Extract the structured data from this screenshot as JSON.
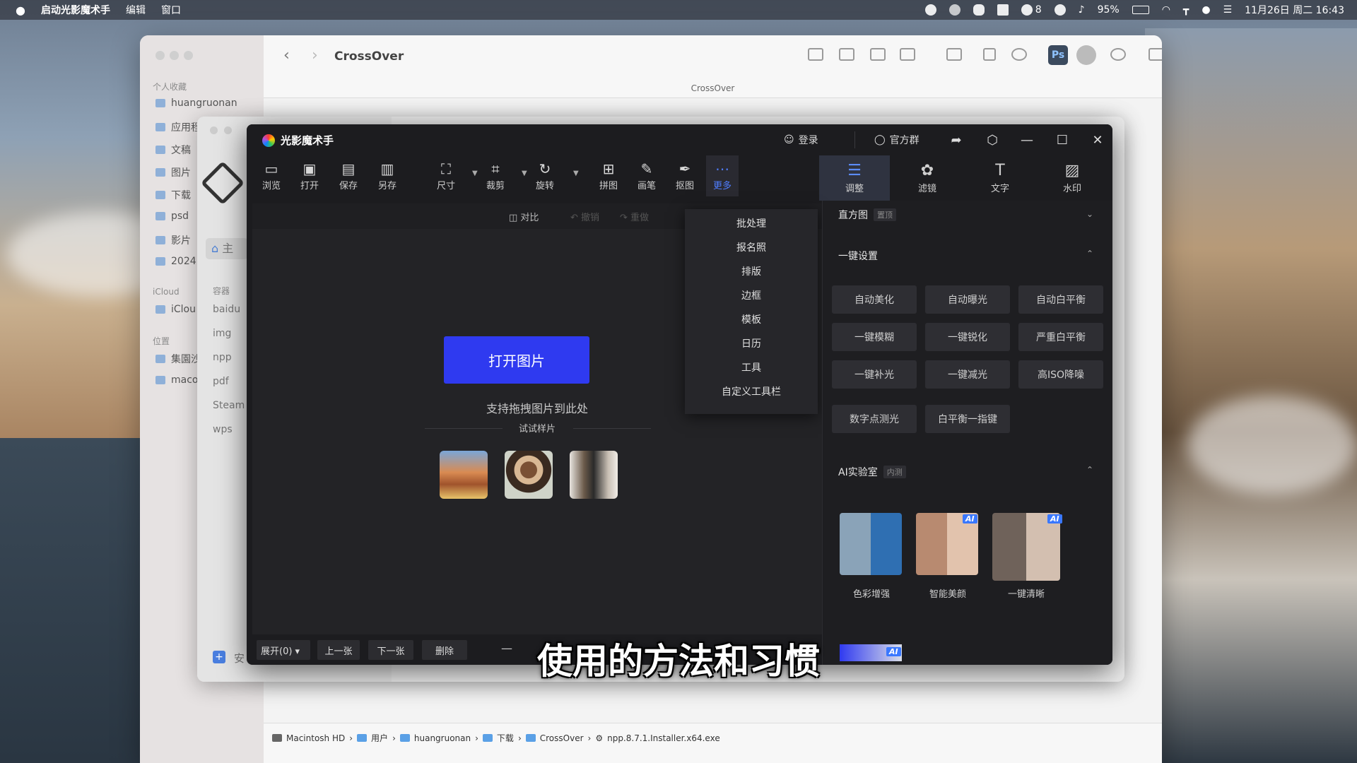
{
  "menubar": {
    "app_name": "启动光影魔术手",
    "menus": [
      "编辑",
      "窗口"
    ],
    "wechat_count": "8",
    "battery": "95%",
    "datetime": "11月26日 周二 16:43"
  },
  "finder": {
    "title": "CrossOver",
    "subtitle": "CrossOver",
    "sidebar_sections": {
      "favorites": "个人收藏",
      "icloud": "iCloud",
      "locations": "位置"
    },
    "favorites": [
      "huangruonan",
      "应用程",
      "文稿",
      "图片",
      "下载",
      "psd",
      "影片",
      "2024"
    ],
    "icloud_items": [
      "iClou"
    ],
    "locations": [
      "集園沙",
      "maco"
    ],
    "path": [
      "Macintosh HD",
      "用户",
      "huangruonan",
      "下载",
      "CrossOver",
      "npp.8.7.1.Installer.x64.exe"
    ]
  },
  "crossover": {
    "home_label": "主",
    "section": "容器",
    "items": [
      "baidu",
      "img",
      "npp",
      "pdf",
      "Steam",
      "wps"
    ],
    "add_label": "安"
  },
  "app": {
    "title": "光影魔术手",
    "login": "登录",
    "group": "官方群",
    "tools": [
      "浏览",
      "打开",
      "保存",
      "另存",
      "尺寸",
      "裁剪",
      "旋转",
      "拼图",
      "画笔",
      "抠图",
      "更多"
    ],
    "right_tools": [
      "调整",
      "滤镜",
      "文字",
      "水印"
    ],
    "subbar": {
      "compare": "对比",
      "undo": "撤销",
      "redo": "重做"
    },
    "open_button": "打开图片",
    "drag_hint": "支持拖拽图片到此处",
    "try_sample": "试试样片",
    "more_menu": [
      "批处理",
      "报名照",
      "排版",
      "边框",
      "模板",
      "日历",
      "工具",
      "自定义工具栏"
    ],
    "panel": {
      "histogram": {
        "title": "直方图",
        "tag": "置顶"
      },
      "oneclick": {
        "title": "一键设置",
        "buttons": [
          "自动美化",
          "自动曝光",
          "自动白平衡",
          "一键模糊",
          "一键锐化",
          "严重白平衡",
          "一键补光",
          "一键减光",
          "高ISO降噪",
          "数字点测光",
          "白平衡一指键"
        ]
      },
      "ailab": {
        "title": "AI实验室",
        "tag": "内测",
        "items": [
          "色彩增强",
          "智能美颜",
          "一键清晰"
        ],
        "badge": "AI"
      }
    },
    "bottom": {
      "expand": "展开(0)",
      "prev": "上一张",
      "next": "下一张",
      "delete": "删除"
    }
  },
  "subtitle": "使用的方法和习惯"
}
